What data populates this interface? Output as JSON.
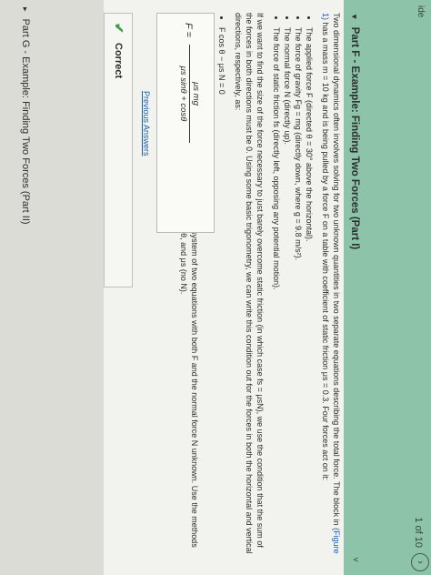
{
  "topbar": {
    "title": "ide",
    "pager": "1 of 10",
    "next_icon": "›"
  },
  "part_f": {
    "caret": "▾",
    "title": "Part F - Example: Finding Two Forces (Part I)",
    "collapse_icon": "˅"
  },
  "content": {
    "intro_1": "Two dimensional dynamics often involves solving for two unknown quantities in two separate equations describing the total force. The block in ",
    "figure_link": "(Figure 1)",
    "intro_2": " has a mass m = 10 kg and is being pulled by a force F on a table with coefficient of static friction μs = 0.3. Four forces act on it:",
    "bullets": [
      "The applied force F (directed θ = 30° above the horizontal).",
      "The force of gravity Fg = mg (directly down, where g = 9.8 m/s²).",
      "The normal force N (directly up).",
      "The force of static friction fs (directly left, opposing any potential motion)."
    ],
    "para_2": "If we want to find the size of the force necessary to just barely overcome static friction (in which case fs = μsN), we use the condition that the sum of the forces in both directions must be 0. Using some basic trigonometry, we can write this condition out for the forces in both the horizontal and vertical directions, respectively, as:",
    "equations": [
      "F cos θ − μs N = 0",
      "F sin θ + N − mg = 0"
    ],
    "para_3": "In order to find the magnitude of force F, we have to solve a system of two equations with both F and the normal force N unknown. Use the methods we have learned to find an expression for F in terms of m, g, θ, and μs (no N).",
    "hints": "▸ View Available Hint(s)"
  },
  "answer": {
    "lhs": "F =",
    "numerator": "μs mg",
    "denominator": "μs sinθ + cosθ",
    "previous_answers": "Previous Answers"
  },
  "result": {
    "icon": "✔",
    "label": "Correct"
  },
  "part_g": {
    "caret": "▸",
    "title": "Part G - Example: Finding Two Forces (Part II)"
  }
}
